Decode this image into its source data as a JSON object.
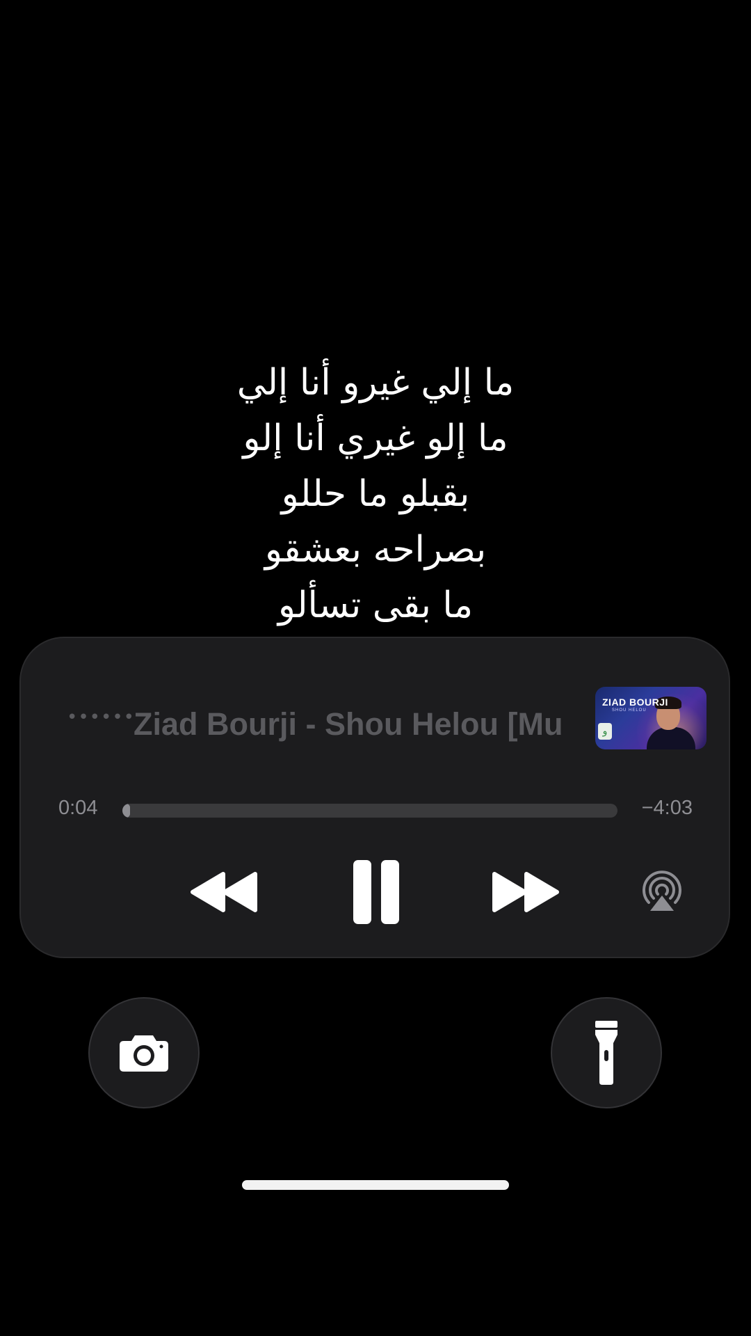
{
  "lyrics": {
    "lines": [
      "ما إلي غيرو أنا إلي",
      "ما إلو غيري أنا إلو",
      "بقبلو ما حللو",
      "بصراحه بعشقو",
      "ما بقى تسألو"
    ]
  },
  "now_playing": {
    "title": "Ziad Bourji - Shou Helou [Mu",
    "artwork": {
      "artist_text": "ZIAD BOURJI",
      "sub_text": "SHOU HELOU",
      "badge": "و"
    },
    "elapsed": "0:04",
    "remaining": "−4:03",
    "progress_fraction": 0.016,
    "icons": {
      "rewind": "backward-icon",
      "pause": "pause-icon",
      "forward": "forward-icon",
      "airplay": "airplay-icon"
    }
  },
  "lock_screen": {
    "camera_icon": "camera-icon",
    "flashlight_icon": "flashlight-icon"
  },
  "colors": {
    "background": "#000000",
    "card": "#1c1c1e",
    "muted_text": "#5a5a5e",
    "secondary_text": "#8e8e93"
  }
}
